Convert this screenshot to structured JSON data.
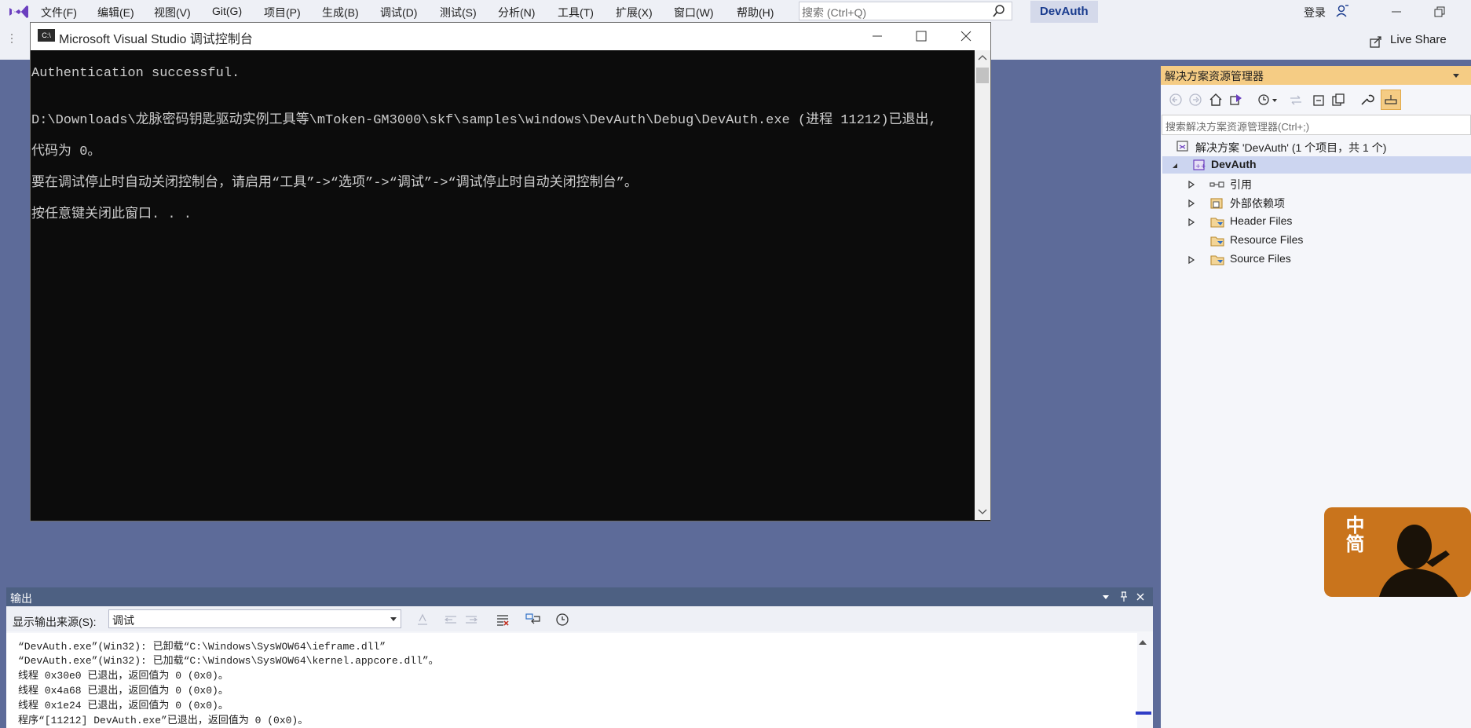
{
  "menubar": {
    "items": [
      "文件(F)",
      "编辑(E)",
      "视图(V)",
      "Git(G)",
      "项目(P)",
      "生成(B)",
      "调试(D)",
      "测试(S)",
      "分析(N)",
      "工具(T)",
      "扩展(X)",
      "窗口(W)",
      "帮助(H)"
    ],
    "search_placeholder": "搜索 (Ctrl+Q)",
    "solution_name": "DevAuth",
    "login": "登录"
  },
  "toolbar": {
    "live_share": "Live Share"
  },
  "console": {
    "title": "Microsoft Visual Studio 调试控制台",
    "icon_text": "C:\\",
    "lines": [
      "Authentication successful.",
      "",
      "D:\\Downloads\\龙脉密码钥匙驱动实例工具等\\mToken-GM3000\\skf\\samples\\windows\\DevAuth\\Debug\\DevAuth.exe (进程 11212)已退出,",
      "代码为 0。",
      "要在调试停止时自动关闭控制台，请启用“工具”->“选项”->“调试”->“调试停止时自动关闭控制台”。",
      "按任意键关闭此窗口. . ."
    ]
  },
  "solution_explorer": {
    "title": "解决方案资源管理器",
    "search_placeholder": "搜索解决方案资源管理器(Ctrl+;)",
    "solution_label": "解决方案 'DevAuth' (1 个项目，共 1 个)",
    "project": "DevAuth",
    "nodes": [
      "引用",
      "外部依赖项",
      "Header Files",
      "Resource Files",
      "Source Files"
    ]
  },
  "output": {
    "title": "输出",
    "source_label": "显示输出来源(S):",
    "source_value": "调试",
    "lines": [
      "“DevAuth.exe”(Win32): 已卸载“C:\\Windows\\SysWOW64\\ieframe.dll”",
      "“DevAuth.exe”(Win32): 已加载“C:\\Windows\\SysWOW64\\kernel.appcore.dll”。",
      "线程 0x30e0 已退出，返回值为 0 (0x0)。",
      "线程 0x4a68 已退出，返回值为 0 (0x0)。",
      "线程 0x1e24 已退出，返回值为 0 (0x0)。",
      "程序“[11212] DevAuth.exe”已退出，返回值为 0 (0x0)。"
    ]
  },
  "avatar": {
    "badge_text": "中简"
  },
  "colors": {
    "accent": "#1b3d8f",
    "panel_header": "#f5cc84",
    "background": "#5d6b99",
    "output_header": "#4d6082"
  }
}
